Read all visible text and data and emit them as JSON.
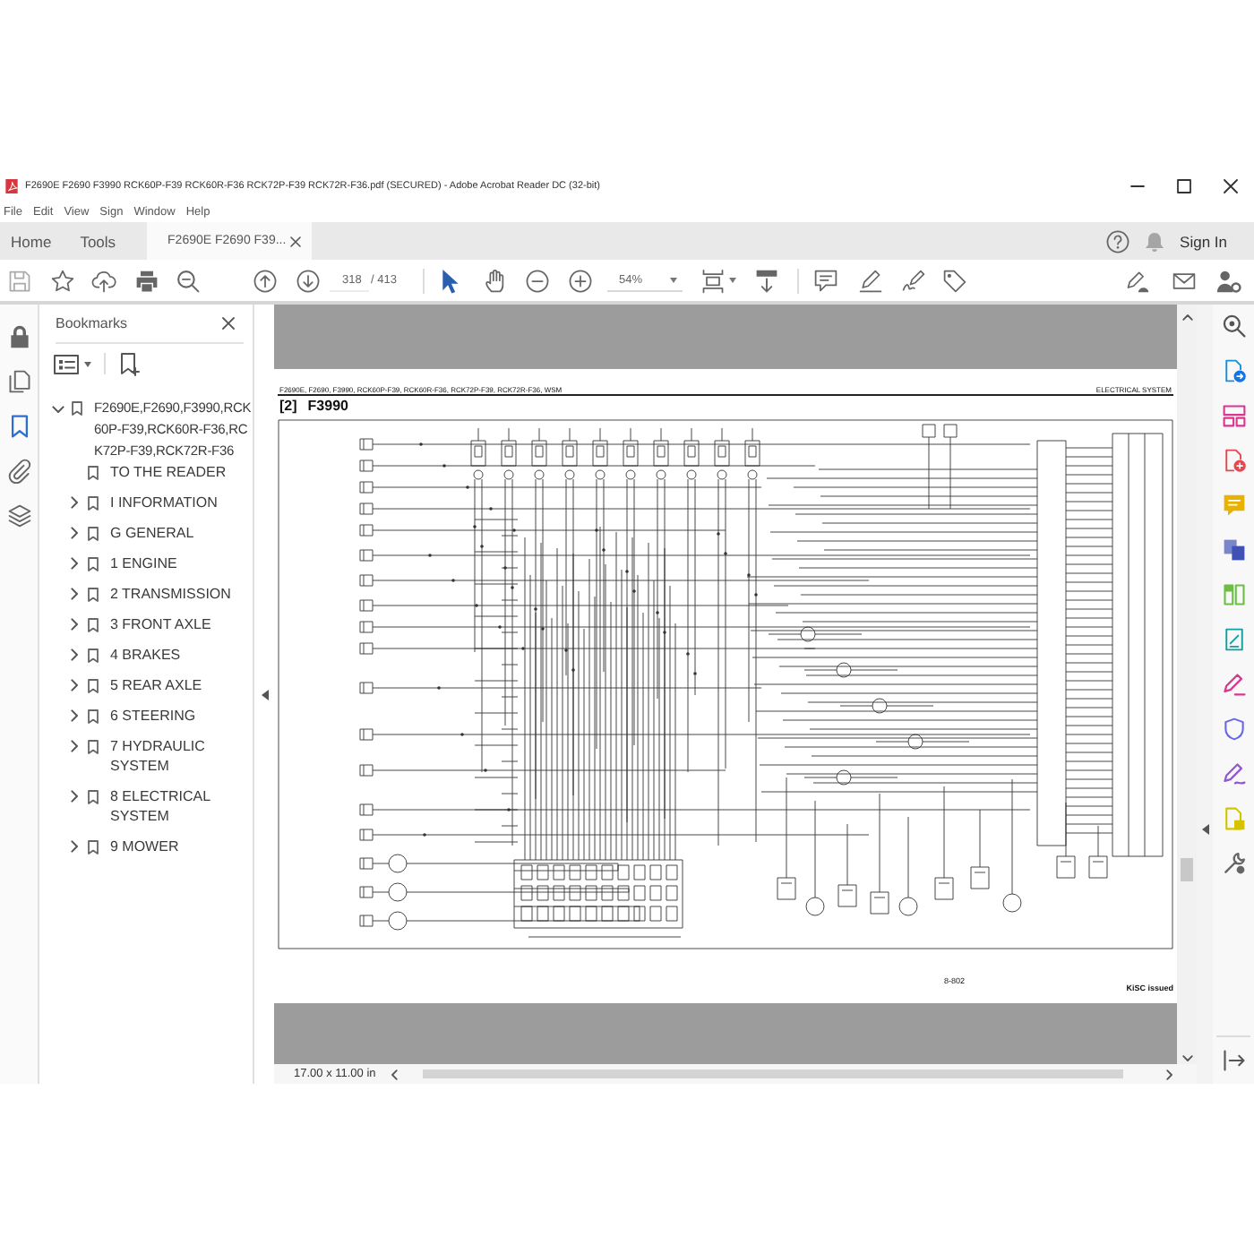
{
  "window": {
    "title": "F2690E F2690 F3990 RCK60P-F39 RCK60R-F36 RCK72P-F39 RCK72R-F36.pdf (SECURED) - Adobe Acrobat Reader DC (32-bit)"
  },
  "menu": [
    "File",
    "Edit",
    "View",
    "Sign",
    "Window",
    "Help"
  ],
  "tabs": [
    {
      "kind": "nav",
      "label": "Home",
      "selected": false
    },
    {
      "kind": "nav",
      "label": "Tools",
      "selected": false
    },
    {
      "kind": "document",
      "label": "F2690E F2690 F39...",
      "selected": true
    }
  ],
  "account": {
    "sign_in": "Sign In"
  },
  "toolbar": {
    "page": "318",
    "page_total": "/ 413",
    "zoom": "54%"
  },
  "left_rail": [
    {
      "selected": false
    },
    {
      "selected": false
    },
    {
      "selected": true
    },
    {
      "selected": false
    },
    {
      "selected": false
    }
  ],
  "bookmarks": {
    "title": "Bookmarks",
    "tree": [
      {
        "kind": "branch",
        "label": "F2690E,F2690,F3990,RCK60P-F39,RCK60R-F36,RCK72P-F39,RCK72R-F36",
        "expanded": true,
        "children": [
          {
            "kind": "leaf",
            "label": "TO THE READER"
          },
          {
            "kind": "branch",
            "label": "I INFORMATION",
            "expanded": false
          },
          {
            "kind": "branch",
            "label": "G GENERAL",
            "expanded": false
          },
          {
            "kind": "branch",
            "label": "1 ENGINE",
            "expanded": false
          },
          {
            "kind": "branch",
            "label": "2 TRANSMISSION",
            "expanded": false
          },
          {
            "kind": "branch",
            "label": "3 FRONT AXLE",
            "expanded": false
          },
          {
            "kind": "branch",
            "label": "4 BRAKES",
            "expanded": false
          },
          {
            "kind": "branch",
            "label": "5 REAR AXLE",
            "expanded": false
          },
          {
            "kind": "branch",
            "label": "6 STEERING",
            "expanded": false
          },
          {
            "kind": "branch",
            "label": "7 HYDRAULIC SYSTEM",
            "expanded": false
          },
          {
            "kind": "branch",
            "label": "8 ELECTRICAL SYSTEM",
            "expanded": false
          },
          {
            "kind": "branch",
            "label": "9 MOWER",
            "expanded": false
          }
        ]
      }
    ]
  },
  "page": {
    "header_left": "F2690E, F2690, F3990, RCK60P-F39, RCK60R-F36, RCK72P-F39, RCK72R-F36, WSM",
    "header_right": "ELECTRICAL SYSTEM",
    "section_number": "[2]",
    "section_title": "F3990",
    "page_number": "8-802",
    "footer_right": "KiSC issued"
  },
  "status_bar": {
    "page_size": "17.00 x 11.00 in"
  }
}
